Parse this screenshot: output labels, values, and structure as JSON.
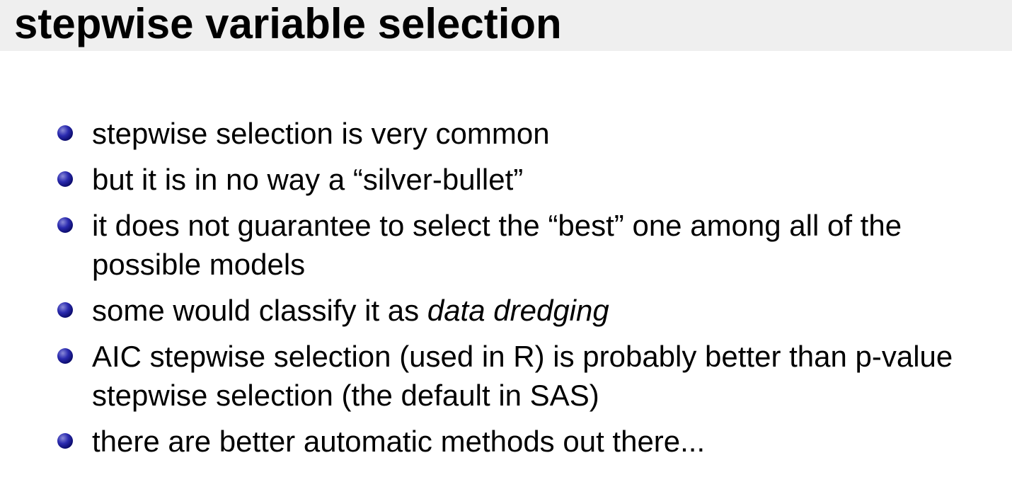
{
  "slide": {
    "title": "stepwise variable selection",
    "bullets": [
      {
        "text": "stepwise selection is very common"
      },
      {
        "text": "but it is in no way a “silver-bullet”"
      },
      {
        "text": "it does not guarantee to select the “best” one among all of the possible models"
      },
      {
        "before": "some would classify it as ",
        "emphasis": "data dredging"
      },
      {
        "text": "AIC stepwise selection (used in R) is probably better than p-value stepwise selection (the default in SAS)"
      },
      {
        "text": "there are better automatic methods out there..."
      }
    ]
  },
  "colors": {
    "title_bar_background": "#efefef",
    "bullet_color": "#1a1a8c",
    "text_color": "#000000"
  },
  "icons": {
    "bullet": "bullet-icon"
  }
}
